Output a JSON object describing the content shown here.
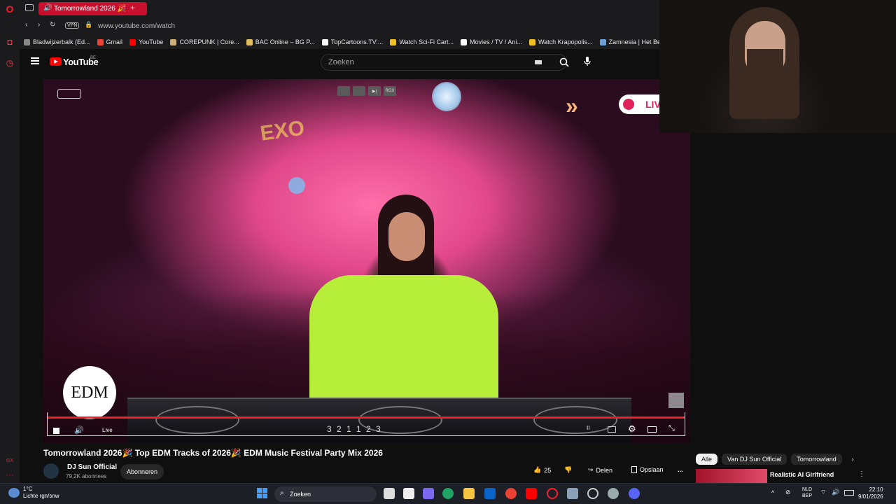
{
  "browser": {
    "tab_title": "Tomorrowland 2026 🎉",
    "new_tab": "+",
    "vpn": "VPN",
    "url": "www.youtube.com/watch",
    "bookmarks": [
      {
        "label": "Bladwijzerbalk (Ed...",
        "color": "#888888"
      },
      {
        "label": "Gmail",
        "color": "#ea4335"
      },
      {
        "label": "YouTube",
        "color": "#ff0000"
      },
      {
        "label": "COREPUNK | Core...",
        "color": "#d0b070"
      },
      {
        "label": "BAC Online – BG P...",
        "color": "#e0c060"
      },
      {
        "label": "TopCartoons.TV:...",
        "color": "#ffffff"
      },
      {
        "label": "Watch Sci-Fi Cart...",
        "color": "#f0c020"
      },
      {
        "label": "Movies / TV / Ani...",
        "color": "#ffffff"
      },
      {
        "label": "Watch Krapopolis...",
        "color": "#f0c020"
      },
      {
        "label": "Zamnesia | Het Be",
        "color": "#6a9fd8"
      }
    ]
  },
  "youtube": {
    "logo": "YouTube",
    "region": "BE",
    "search_placeholder": "Zoeken"
  },
  "video": {
    "edm_logo": "EDM",
    "live_badge": "LIVE",
    "player_top_buttons": [
      "",
      "",
      "",
      "RGX"
    ],
    "live_label": "Live",
    "deck_readout": "3 2 1   1 2 3"
  },
  "below_video": {
    "title": "Tomorrowland 2026🎉 Top EDM Tracks of 2026🎉 EDM Music Festival Party Mix 2026",
    "channel_name": "DJ Sun Official",
    "subscribers": "79,2K abonnees",
    "subscribe": "Abonneren",
    "likes": "25",
    "share": "Delen",
    "save": "Opslaan",
    "more": "..."
  },
  "sidebar_chips": [
    "Alle",
    "Van DJ Sun Official",
    "Tomorrowland"
  ],
  "suggestion": {
    "title": "Realistic AI Girlfriend"
  },
  "taskbar": {
    "temp": "1°C",
    "weather": "Lichte rgn/snw",
    "search": "Zoeken",
    "lang_1": "NLD",
    "lang_2": "BEP",
    "time": "22:10",
    "date": "9/01/2026"
  },
  "colors": {
    "accent_red": "#c8102e",
    "yt_red": "#ff0000",
    "progress": "#ee2222"
  }
}
